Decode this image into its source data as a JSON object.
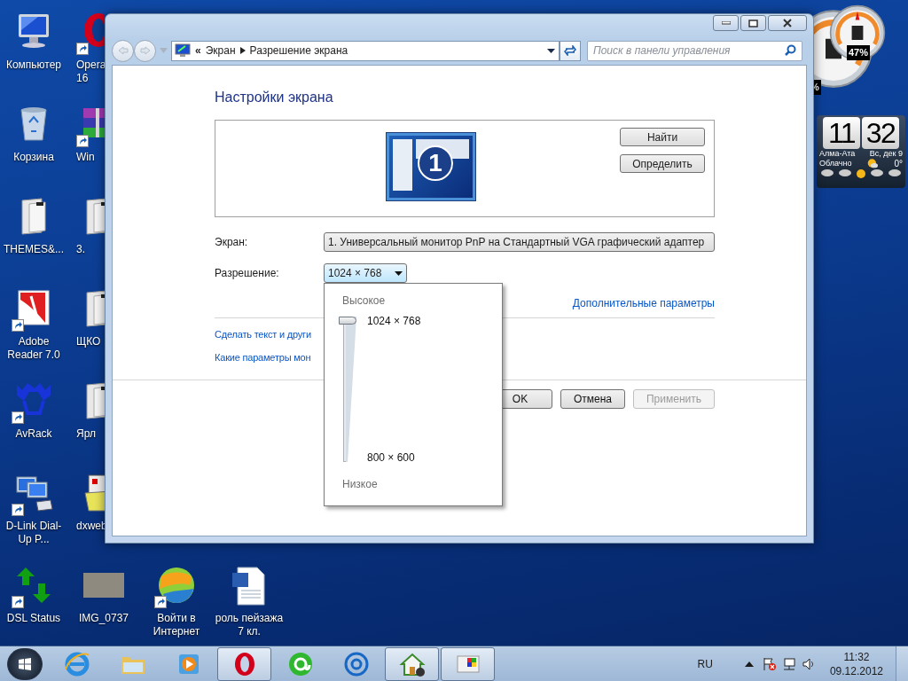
{
  "desktop": {
    "icon_columns": [
      [
        {
          "label": "Компьютер",
          "kind": "computer",
          "shortcut": false
        },
        {
          "label": "Корзина",
          "kind": "recycle-bin",
          "shortcut": false
        },
        {
          "label": "THEMES&...",
          "kind": "folder",
          "shortcut": false
        },
        {
          "label": "Adobe Reader 7.0",
          "kind": "pdf",
          "shortcut": true
        },
        {
          "label": "AvRack",
          "kind": "audio",
          "shortcut": true
        },
        {
          "label": "D-Link Dial-Up P...",
          "kind": "network",
          "shortcut": true
        }
      ],
      [
        {
          "label": "Opera 16",
          "kind": "browser",
          "shortcut": true
        },
        {
          "label": "Win",
          "kind": "archive",
          "shortcut": true
        },
        {
          "label": "3.",
          "kind": "folder",
          "shortcut": false
        },
        {
          "label": "ЩКО",
          "kind": "folder",
          "shortcut": false
        },
        {
          "label": "Ярл",
          "kind": "folder",
          "shortcut": false
        },
        {
          "label": "dxweb",
          "kind": "installer",
          "shortcut": false
        }
      ]
    ],
    "bottom_row": [
      {
        "label": "DSL Status",
        "kind": "arrows",
        "shortcut": true
      },
      {
        "label": "IMG_0737",
        "kind": "photo",
        "shortcut": false
      },
      {
        "label": "Войти в Интернет",
        "kind": "globe",
        "shortcut": true
      },
      {
        "label": "роль пейзажа 7 кл.",
        "kind": "document",
        "shortcut": false
      }
    ]
  },
  "gadgets": {
    "cpu_meter": {
      "reading": "47%",
      "hidden_reading": "%"
    },
    "clock": {
      "hours": "11",
      "minutes": "32",
      "city": "Алма-Ата",
      "condition": "Облачно",
      "date": "Вс, дек 9",
      "temperature": "0°"
    }
  },
  "window": {
    "address": {
      "prefix": "«",
      "crumbs": [
        "Экран",
        "Разрешение экрана"
      ]
    },
    "search": {
      "placeholder": "Поиск в панели управления"
    },
    "heading": "Настройки экрана",
    "preview": {
      "number": "1",
      "buttons": [
        "Найти",
        "Определить"
      ]
    },
    "fields": [
      {
        "label": "Экран:",
        "value": "1. Универсальный монитор PnP на Стандартный VGA графический адаптер",
        "expanded": false
      },
      {
        "label": "Разрешение:",
        "value": "1024 × 768",
        "expanded": true
      }
    ],
    "advanced_link": "Дополнительные параметры",
    "links": [
      "Сделать текст и други",
      "Какие параметры мон"
    ],
    "buttons": [
      {
        "label": "OK",
        "disabled": false
      },
      {
        "label": "Отмена",
        "disabled": false
      },
      {
        "label": "Применить",
        "disabled": true
      }
    ],
    "resolution_popup": {
      "top_label": "Высокое",
      "bottom_label": "Низкое",
      "level": 1,
      "marks": [
        "1024 × 768",
        "800 × 600"
      ]
    }
  },
  "taskbar": {
    "items": [
      {
        "kind": "ie",
        "open": false
      },
      {
        "kind": "explorer",
        "open": false
      },
      {
        "kind": "media",
        "open": false
      },
      {
        "kind": "opera",
        "open": true
      },
      {
        "kind": "agent",
        "open": false
      },
      {
        "kind": "mail",
        "open": false
      },
      {
        "kind": "home",
        "open": true
      },
      {
        "kind": "control-panel",
        "open": true
      }
    ],
    "language": "RU",
    "time": "11:32",
    "date": "09.12.2012"
  }
}
